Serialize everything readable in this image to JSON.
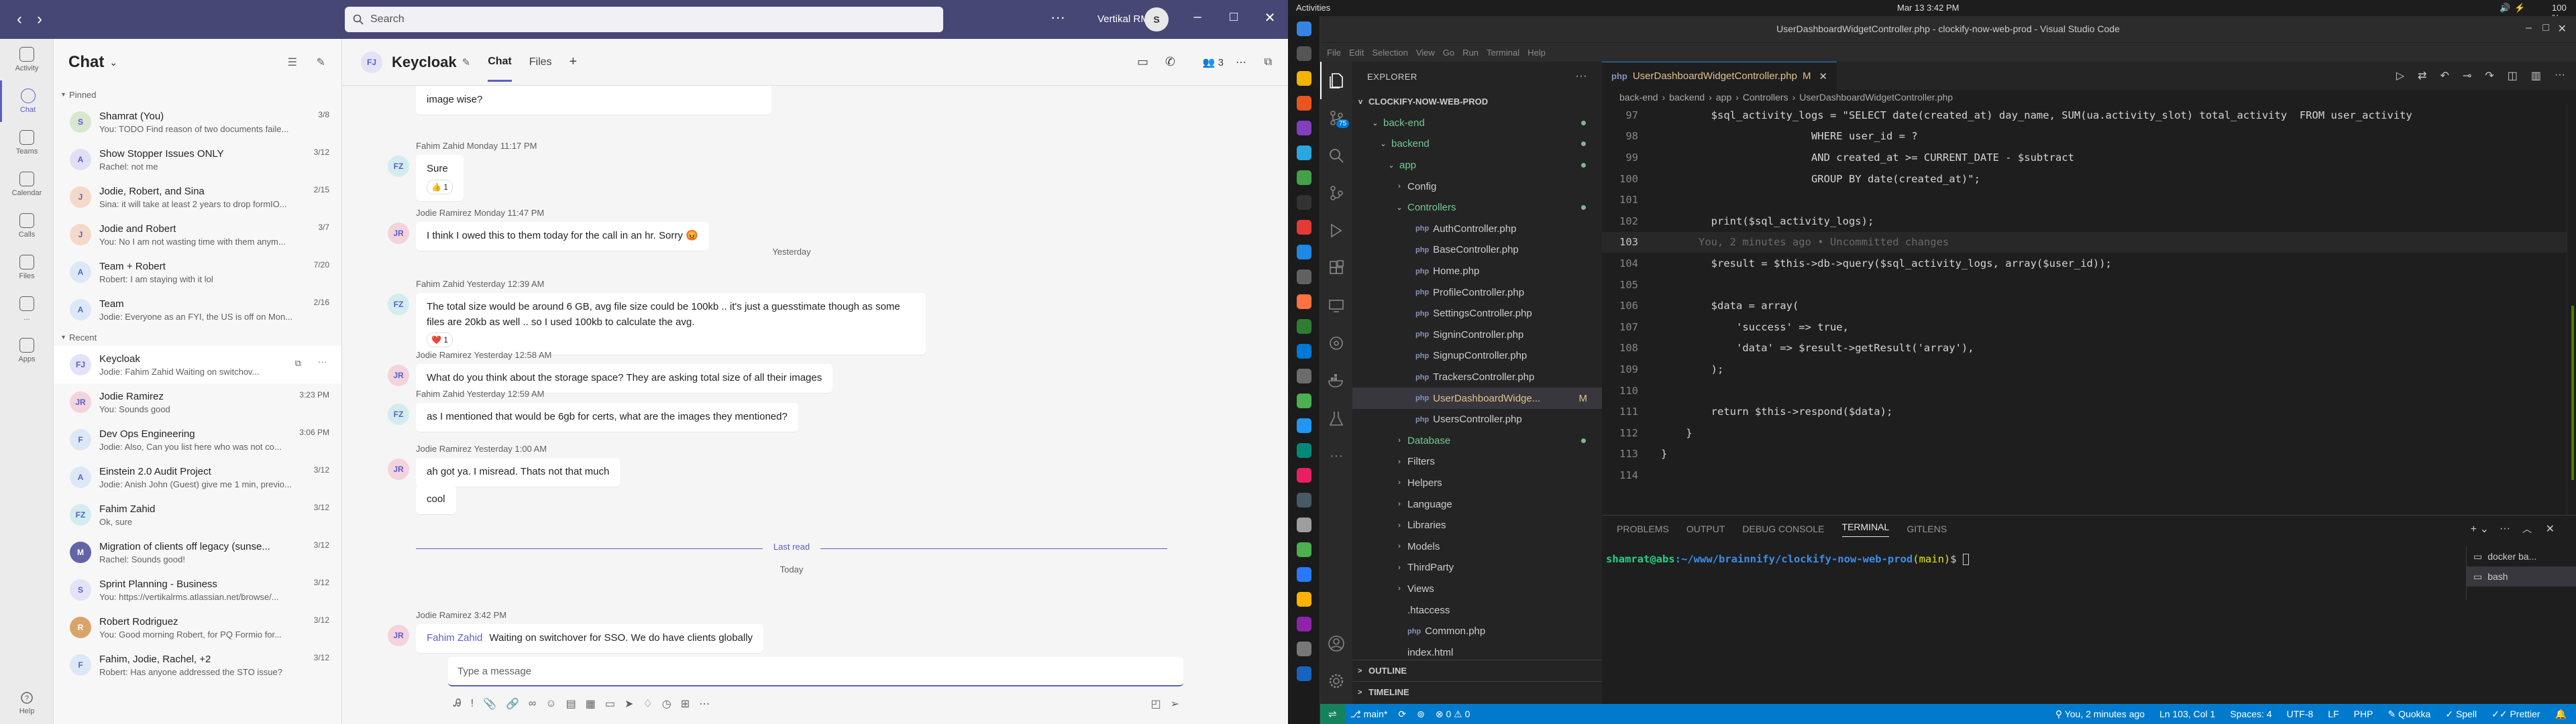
{
  "teams": {
    "search_placeholder": "Search",
    "org_name": "Vertikal RMS",
    "user_initials": "S",
    "rail": [
      {
        "label": "Activity",
        "icon": "bell-icon"
      },
      {
        "label": "Chat",
        "icon": "chat-icon"
      },
      {
        "label": "Teams",
        "icon": "teams-icon"
      },
      {
        "label": "Calendar",
        "icon": "calendar-icon"
      },
      {
        "label": "Calls",
        "icon": "phone-icon"
      },
      {
        "label": "Files",
        "icon": "file-icon"
      },
      {
        "label": "...",
        "icon": "more-icon"
      },
      {
        "label": "Apps",
        "icon": "apps-icon"
      }
    ],
    "help_label": "Help",
    "chat_title": "Chat",
    "pinned_label": "Pinned",
    "recent_label": "Recent",
    "pinned": [
      {
        "name": "Shamrat (You)",
        "preview": "You: TODO Find reason of two documents faile...",
        "time": "3/8",
        "initials": "S",
        "color": "#d8e7d0"
      },
      {
        "name": "Show Stopper Issues ONLY",
        "preview": "Rachel: not me",
        "time": "3/12",
        "initials": "A",
        "color": "#e1dff5"
      },
      {
        "name": "Jodie, Robert, and Sina",
        "preview": "Sina: it will take at least 2 years to drop formIO...",
        "time": "2/15",
        "initials": "J",
        "color": "#f4d9c9"
      },
      {
        "name": "Jodie and Robert",
        "preview": "You: No I am not wasting time with them anym...",
        "time": "3/7",
        "initials": "J",
        "color": "#f4d9c9"
      },
      {
        "name": "Team + Robert",
        "preview": "Robert: I am staying with it lol",
        "time": "7/20",
        "initials": "A",
        "color": "#dde8f7"
      },
      {
        "name": "Team",
        "preview": "Jodie: Everyone as an FYI, the US is off on Mon...",
        "time": "2/16",
        "initials": "A",
        "color": "#dde8f7"
      }
    ],
    "recent": [
      {
        "name": "Keycloak",
        "preview": "Jodie: Fahim Zahid Waiting on switchov...",
        "time": "",
        "initials": "FJ",
        "color": "#e3e3f7"
      },
      {
        "name": "Jodie Ramirez",
        "preview": "You: Sounds good",
        "time": "3:23 PM",
        "initials": "JR",
        "color": "#f3d3dc"
      },
      {
        "name": "Dev Ops Engineering",
        "preview": "Jodie: Also, Can you list here who was not co...",
        "time": "3:06 PM",
        "initials": "F",
        "color": "#dde8f7"
      },
      {
        "name": "Einstein 2.0 Audit Project",
        "preview": "Jodie: Anish John (Guest) give me 1 min, previo...",
        "time": "3/12",
        "initials": "A",
        "color": "#dde8f7"
      },
      {
        "name": "Fahim Zahid",
        "preview": "Ok, sure",
        "time": "3/12",
        "initials": "FZ",
        "color": "#d3ecef"
      },
      {
        "name": "Migration of clients off legacy (sunse...",
        "preview": "Rachel: Sounds good!",
        "time": "3/12",
        "initials": "M",
        "color": "#6264a7"
      },
      {
        "name": "Sprint Planning - Business",
        "preview": "You: https://vertikalrms.atlassian.net/browse/...",
        "time": "3/12",
        "initials": "S",
        "color": "#e3e3f7"
      },
      {
        "name": "Robert Rodriguez",
        "preview": "You: Good morning Robert, for PQ Formio for...",
        "time": "3/12",
        "initials": "R",
        "color": "#d9a46b"
      },
      {
        "name": "Fahim, Jodie, Rachel, +2",
        "preview": "Robert: Has anyone addressed the STO issue?",
        "time": "3/12",
        "initials": "F",
        "color": "#dde8f7"
      }
    ],
    "conversation": {
      "title": "Keycloak",
      "avatar_initials": "FJ",
      "tab_chat": "Chat",
      "tab_files": "Files",
      "participants": "3",
      "top_partial": "image wise?",
      "messages": [
        {
          "meta": "Fahim Zahid   Monday 11:17 PM",
          "text": "Sure",
          "initials": "FZ",
          "reaction": "👍 1"
        },
        {
          "meta": "Jodie Ramirez   Monday 11:47 PM",
          "text": "I think I owed this to them today for the call in an hr.  Sorry 😡",
          "initials": "JR",
          "reaction": ""
        },
        {
          "meta": "Fahim Zahid   Yesterday 12:39 AM",
          "text": "The total size would be around 6 GB, avg file size could be 100kb .. it's just a guesstimate though as some files are 20kb as well .. so I used 100kb to calculate the avg.",
          "initials": "FZ",
          "reaction": "❤️ 1"
        },
        {
          "meta": "Jodie Ramirez   Yesterday 12:58 AM",
          "text": "What do you think about the storage space?  They are asking total size of all their images",
          "initials": "JR",
          "reaction": ""
        },
        {
          "meta": "Fahim Zahid   Yesterday 12:59 AM",
          "text": "as I mentioned that would be 6gb for certs, what are the images they mentioned?",
          "initials": "FZ",
          "reaction": ""
        },
        {
          "meta": "Jodie Ramirez   Yesterday 1:00 AM",
          "text": "ah got ya.  I misread.  Thats not that much",
          "initials": "JR",
          "reaction": ""
        },
        {
          "meta": "",
          "text": "cool",
          "initials": "",
          "reaction": ""
        },
        {
          "meta": "Jodie Ramirez   3:42 PM",
          "text": "Waiting on switchover for SSO.  We do have clients globally",
          "mention": "Fahim Zahid",
          "initials": "JR",
          "reaction": ""
        }
      ],
      "sep_yesterday": "Yesterday",
      "last_read": "Last read",
      "sep_today": "Today",
      "compose_placeholder": "Type a message"
    }
  },
  "ubuntu": {
    "activities": "Activities",
    "clock": "Mar 13  3:42 PM",
    "battery": "100 %"
  },
  "vscode": {
    "window_title": "UserDashboardWidgetController.php - clockify-now-web-prod - Visual Studio Code",
    "menu": [
      "File",
      "Edit",
      "Selection",
      "View",
      "Go",
      "Run",
      "Terminal",
      "Help"
    ],
    "explorer_label": "EXPLORER",
    "project": "CLOCKIFY-NOW-WEB-PROD",
    "scm_badge": "75",
    "tree": [
      {
        "label": "back-end",
        "indent": 1,
        "arrow": "v",
        "color": "#73c991",
        "dot": true
      },
      {
        "label": "backend",
        "indent": 2,
        "arrow": "v",
        "color": "#73c991",
        "dot": true
      },
      {
        "label": "app",
        "indent": 3,
        "arrow": "v",
        "color": "#73c991",
        "dot": true
      },
      {
        "label": "Config",
        "indent": 4,
        "arrow": ">",
        "color": "#cccccc",
        "dot": false
      },
      {
        "label": "Controllers",
        "indent": 4,
        "arrow": "v",
        "color": "#73c991",
        "dot": true
      },
      {
        "label": "AuthController.php",
        "indent": 5,
        "arrow": "",
        "color": "#cccccc",
        "dot": false,
        "php": true
      },
      {
        "label": "BaseController.php",
        "indent": 5,
        "arrow": "",
        "color": "#cccccc",
        "dot": false,
        "php": true
      },
      {
        "label": "Home.php",
        "indent": 5,
        "arrow": "",
        "color": "#cccccc",
        "dot": false,
        "php": true
      },
      {
        "label": "ProfileController.php",
        "indent": 5,
        "arrow": "",
        "color": "#cccccc",
        "dot": false,
        "php": true
      },
      {
        "label": "SettingsController.php",
        "indent": 5,
        "arrow": "",
        "color": "#cccccc",
        "dot": false,
        "php": true
      },
      {
        "label": "SigninController.php",
        "indent": 5,
        "arrow": "",
        "color": "#cccccc",
        "dot": false,
        "php": true
      },
      {
        "label": "SignupController.php",
        "indent": 5,
        "arrow": "",
        "color": "#cccccc",
        "dot": false,
        "php": true
      },
      {
        "label": "TrackersController.php",
        "indent": 5,
        "arrow": "",
        "color": "#cccccc",
        "dot": false,
        "php": true
      },
      {
        "label": "UserDashboardWidge...",
        "indent": 5,
        "arrow": "",
        "color": "#e2c08d",
        "dot": false,
        "php": true,
        "badge": "M",
        "sel": true
      },
      {
        "label": "UsersController.php",
        "indent": 5,
        "arrow": "",
        "color": "#cccccc",
        "dot": false,
        "php": true
      },
      {
        "label": "Database",
        "indent": 4,
        "arrow": ">",
        "color": "#73c991",
        "dot": true
      },
      {
        "label": "Filters",
        "indent": 4,
        "arrow": ">",
        "color": "#cccccc",
        "dot": false
      },
      {
        "label": "Helpers",
        "indent": 4,
        "arrow": ">",
        "color": "#cccccc",
        "dot": false
      },
      {
        "label": "Language",
        "indent": 4,
        "arrow": ">",
        "color": "#cccccc",
        "dot": false
      },
      {
        "label": "Libraries",
        "indent": 4,
        "arrow": ">",
        "color": "#cccccc",
        "dot": false
      },
      {
        "label": "Models",
        "indent": 4,
        "arrow": ">",
        "color": "#cccccc",
        "dot": false
      },
      {
        "label": "ThirdParty",
        "indent": 4,
        "arrow": ">",
        "color": "#cccccc",
        "dot": false
      },
      {
        "label": "Views",
        "indent": 4,
        "arrow": ">",
        "color": "#cccccc",
        "dot": false
      },
      {
        "label": ".htaccess",
        "indent": 4,
        "arrow": "",
        "color": "#cccccc",
        "dot": false
      },
      {
        "label": "Common.php",
        "indent": 4,
        "arrow": "",
        "color": "#cccccc",
        "dot": false,
        "php": true
      },
      {
        "label": "index.html",
        "indent": 4,
        "arrow": "",
        "color": "#cccccc",
        "dot": false
      }
    ],
    "outline_label": "OUTLINE",
    "timeline_label": "TIMELINE",
    "tab_file": "UserDashboardWidgetController.php",
    "tab_badge": "M",
    "breadcrumb": [
      "back-end",
      "backend",
      "app",
      "Controllers",
      "UserDashboardWidgetController.php"
    ],
    "code_lines": [
      {
        "n": "97",
        "t": "        $sql_activity_logs = \"SELECT date(created_at) day_name, SUM(ua.activity_slot) total_activity  FROM user_activity"
      },
      {
        "n": "98",
        "t": "                        WHERE user_id = ?"
      },
      {
        "n": "99",
        "t": "                        AND created_at >= CURRENT_DATE - $subtract"
      },
      {
        "n": "100",
        "t": "                        GROUP BY date(created_at)\";"
      },
      {
        "n": "101",
        "t": ""
      },
      {
        "n": "102",
        "t": "        print($sql_activity_logs);"
      },
      {
        "n": "103",
        "t": "      You, 2 minutes ago • Uncommitted changes",
        "cur": true
      },
      {
        "n": "104",
        "t": "        $result = $this->db->query($sql_activity_logs, array($user_id));"
      },
      {
        "n": "105",
        "t": ""
      },
      {
        "n": "106",
        "t": "        $data = array("
      },
      {
        "n": "107",
        "t": "            'success' => true,"
      },
      {
        "n": "108",
        "t": "            'data' => $result->getResult('array'),"
      },
      {
        "n": "109",
        "t": "        );"
      },
      {
        "n": "110",
        "t": ""
      },
      {
        "n": "111",
        "t": "        return $this->respond($data);"
      },
      {
        "n": "112",
        "t": "    }"
      },
      {
        "n": "113",
        "t": "}"
      },
      {
        "n": "114",
        "t": ""
      }
    ],
    "panel_tabs": [
      "PROBLEMS",
      "OUTPUT",
      "DEBUG CONSOLE",
      "TERMINAL",
      "GITLENS"
    ],
    "prompt_user": "shamrat@abs",
    "prompt_path": ":~/www/brainnify/clockify-now-web-prod",
    "prompt_branch": "(main)",
    "prompt_end": "$ ",
    "terminals": [
      "docker ba...",
      "bash"
    ],
    "status": {
      "branch": "main*",
      "problems": "⊗ 0 ⚠ 0",
      "blame": "You, 2 minutes ago",
      "position": "Ln 103, Col 1",
      "spaces": "Spaces: 4",
      "encoding": "UTF-8",
      "eol": "LF",
      "lang": "PHP",
      "ext1": "Quokka",
      "ext2": "Spell",
      "ext3": "Prettier"
    }
  }
}
